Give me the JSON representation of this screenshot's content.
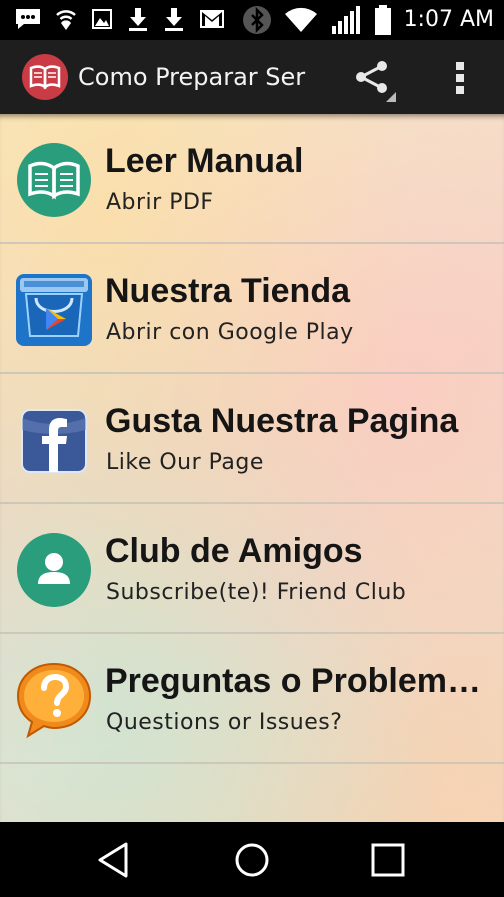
{
  "status_bar": {
    "time": "1:07 AM",
    "left_icons": [
      "message-icon",
      "hotspot-icon",
      "image-icon",
      "download-icon",
      "download-icon",
      "gmail-icon"
    ],
    "right_icons": [
      "bluetooth-icon",
      "wifi-icon",
      "signal-icon",
      "battery-icon"
    ]
  },
  "app_bar": {
    "title": "Como Preparar Ser",
    "logo_icon": "book-icon",
    "actions": [
      "share-icon",
      "overflow-menu-icon"
    ],
    "background": "#1e1e1e"
  },
  "menu": {
    "items": [
      {
        "title": "Leer Manual",
        "subtitle": "Abrir PDF",
        "icon": "book-icon",
        "icon_color": "#2a9d7c"
      },
      {
        "title": "Nuestra Tienda",
        "subtitle": "Abrir con Google Play",
        "icon": "google-play-store-icon",
        "icon_color": "#1e74c9"
      },
      {
        "title": "Gusta Nuestra Pagina",
        "subtitle": "Like Our Page",
        "icon": "facebook-icon",
        "icon_color": "#3b5998"
      },
      {
        "title": "Club de Amigos",
        "subtitle": "Subscribe(te)! Friend Club",
        "icon": "person-icon",
        "icon_color": "#2a9d7c"
      },
      {
        "title": "Preguntas o Problem…",
        "subtitle": "Questions or Issues?",
        "icon": "question-bubble-icon",
        "icon_color": "#f08a1c"
      }
    ]
  },
  "nav_bar": {
    "buttons": [
      "back-icon",
      "home-icon",
      "recents-icon"
    ]
  }
}
